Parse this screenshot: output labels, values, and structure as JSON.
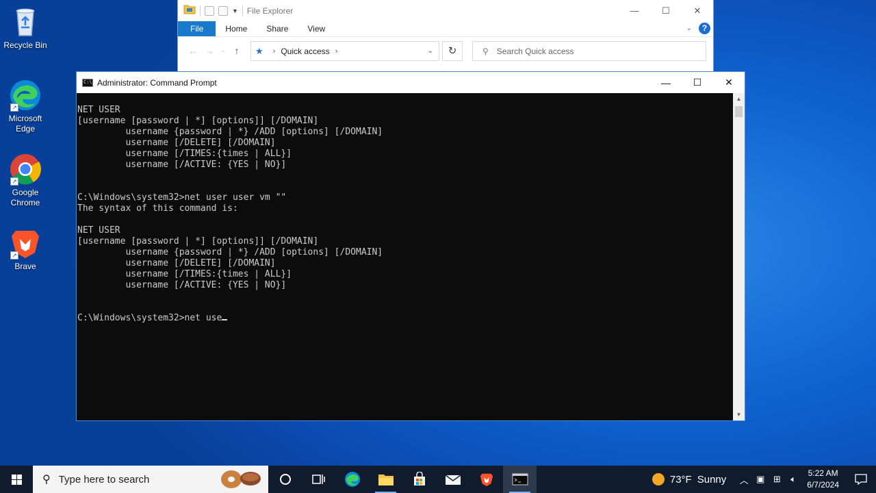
{
  "desktop": {
    "icons": [
      {
        "label": "Recycle Bin"
      },
      {
        "label": "Microsoft Edge"
      },
      {
        "label": "Google Chrome"
      },
      {
        "label": "Brave"
      }
    ]
  },
  "explorer": {
    "title": "File Explorer",
    "tabs": [
      "File",
      "Home",
      "Share",
      "View"
    ],
    "address": "Quick access",
    "search_placeholder": "Search Quick access"
  },
  "cmd": {
    "title": "Administrator: Command Prompt",
    "lines": [
      "NET USER",
      "[username [password | *] [options]] [/DOMAIN]",
      "         username {password | *} /ADD [options] [/DOMAIN]",
      "         username [/DELETE] [/DOMAIN]",
      "         username [/TIMES:{times | ALL}]",
      "         username [/ACTIVE: {YES | NO}]",
      "",
      "",
      "C:\\Windows\\system32>net user user vm \"\"",
      "The syntax of this command is:",
      "",
      "NET USER",
      "[username [password | *] [options]] [/DOMAIN]",
      "         username {password | *} /ADD [options] [/DOMAIN]",
      "         username [/DELETE] [/DOMAIN]",
      "         username [/TIMES:{times | ALL}]",
      "         username [/ACTIVE: {YES | NO}]",
      "",
      ""
    ],
    "current_input": "C:\\Windows\\system32>net use"
  },
  "taskbar": {
    "search_placeholder": "Type here to search",
    "weather_temp": "73°F",
    "weather_desc": "Sunny",
    "time": "5:22 AM",
    "date": "6/7/2024",
    "apps": [
      "task-view-icon",
      "edge-icon",
      "file-explorer-icon",
      "store-icon",
      "mail-icon",
      "brave-icon",
      "cmd-icon"
    ]
  },
  "colors": {
    "desktop_blue": "#0f62cf",
    "console_bg": "#0c0c0c",
    "console_text": "#cccccc",
    "taskbar_bg": "#101c2e",
    "file_tab": "#1979ca"
  }
}
